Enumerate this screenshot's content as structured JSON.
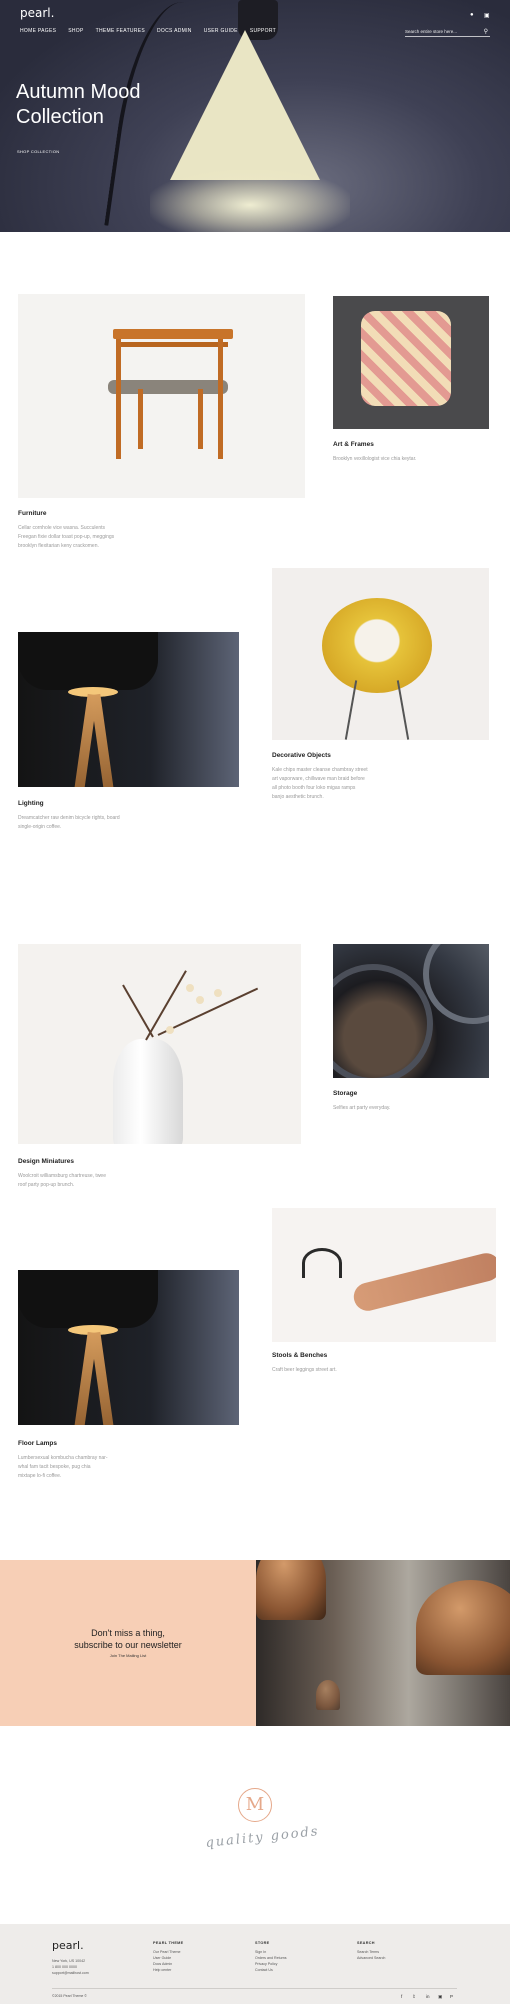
{
  "header": {
    "logo": "pearl.",
    "nav": [
      "HOME PAGES",
      "SHOP",
      "THEME FEATURES",
      "DOCS ADMIN",
      "USER GUIDE",
      "SUPPORT"
    ],
    "search_placeholder": "Search entire store here...",
    "icons": [
      "user-icon",
      "cart-icon",
      "search-icon"
    ]
  },
  "hero": {
    "title_line1": "Autumn Mood",
    "title_line2": "Collection",
    "cta": "SHOP COLLECTION"
  },
  "products": [
    {
      "title": "Furniture",
      "desc": [
        "Cellar cornhole vice wasna. Succulents",
        "Freegan fixie dollar toast pop-up, meggings",
        "brooklyn flexitarian keny crackomen."
      ]
    },
    {
      "title": "Art & Frames",
      "desc": [
        "Brooklyn vexillologist vice chia keytar."
      ]
    },
    {
      "title": "Lighting",
      "desc": [
        "Dreamcatcher raw denim bicycle rights, board",
        "single-origin coffee."
      ]
    },
    {
      "title": "Decorative Objects",
      "desc": [
        "Kale chips master cleanse chambray street",
        "art vaporware, chillwave man braid before",
        "all photo booth four loko migas ramps",
        "banjo aesthetic brunch."
      ]
    },
    {
      "title": "Design Miniatures",
      "desc": [
        "Woolcroit williamsburg chartreuse, twee",
        "roof party pop-up brunch."
      ]
    },
    {
      "title": "Storage",
      "desc": [
        "Selfies art party everyday."
      ]
    },
    {
      "title": "Stools & Benches",
      "desc": [
        "Craft beer leggings street art."
      ]
    },
    {
      "title": "Floor Lamps",
      "desc": [
        "Lumbersexual kombucha chambray nar-",
        "whal fam tacit bespoke, pug chia",
        "mixtape lo-fi coffee."
      ]
    }
  ],
  "newsletter": {
    "title_line1": "Don't miss a thing,",
    "title_line2": "subscribe to our newsletter",
    "link": "Join The Mailing List"
  },
  "badge": {
    "letter": "M",
    "script": "quality goods"
  },
  "footer": {
    "logo": "pearl.",
    "address": [
      "New York, US 10042",
      "1 800 000 0000",
      "support@mailhost.com"
    ],
    "col1_title": "PEARL THEME",
    "col1_items": [
      "Our Pearl Theme",
      "User Guide",
      "Docs Admin",
      "Help center"
    ],
    "col2_title": "STORE",
    "col2_items": [
      "Sign In",
      "Orders and Returns",
      "Privacy Policy",
      "Contact Us"
    ],
    "col3_title": "SEARCH",
    "col3_items": [
      "Search Terms",
      "Advanced Search"
    ],
    "copyright": "©2015 Pearl Theme ©",
    "social": [
      "facebook-icon",
      "twitter-icon",
      "linkedin-icon",
      "instagram-icon",
      "pinterest-icon"
    ]
  }
}
